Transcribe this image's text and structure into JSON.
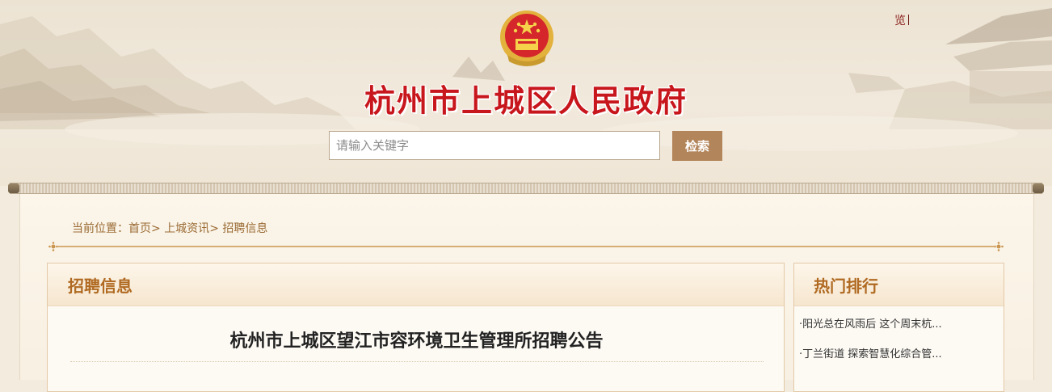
{
  "header": {
    "top_link": "览",
    "site_title": "杭州市上城区人民政府",
    "search_placeholder": "请输入关键字",
    "search_button": "检索"
  },
  "breadcrumb": {
    "prefix": "当前位置：",
    "items": [
      "首页",
      "上城资讯",
      "招聘信息"
    ],
    "separator": ">"
  },
  "main": {
    "section_title": "招聘信息",
    "article_title": "杭州市上城区望江市容环境卫生管理所招聘公告"
  },
  "sidebar": {
    "section_title": "热门排行",
    "items": [
      "·阳光总在风雨后 这个周末杭...",
      "·丁兰街道 探索智慧化综合管..."
    ]
  },
  "colors": {
    "title_red": "#c8161d",
    "accent_brown": "#b3855a",
    "section_title_orange": "#b06a22"
  }
}
